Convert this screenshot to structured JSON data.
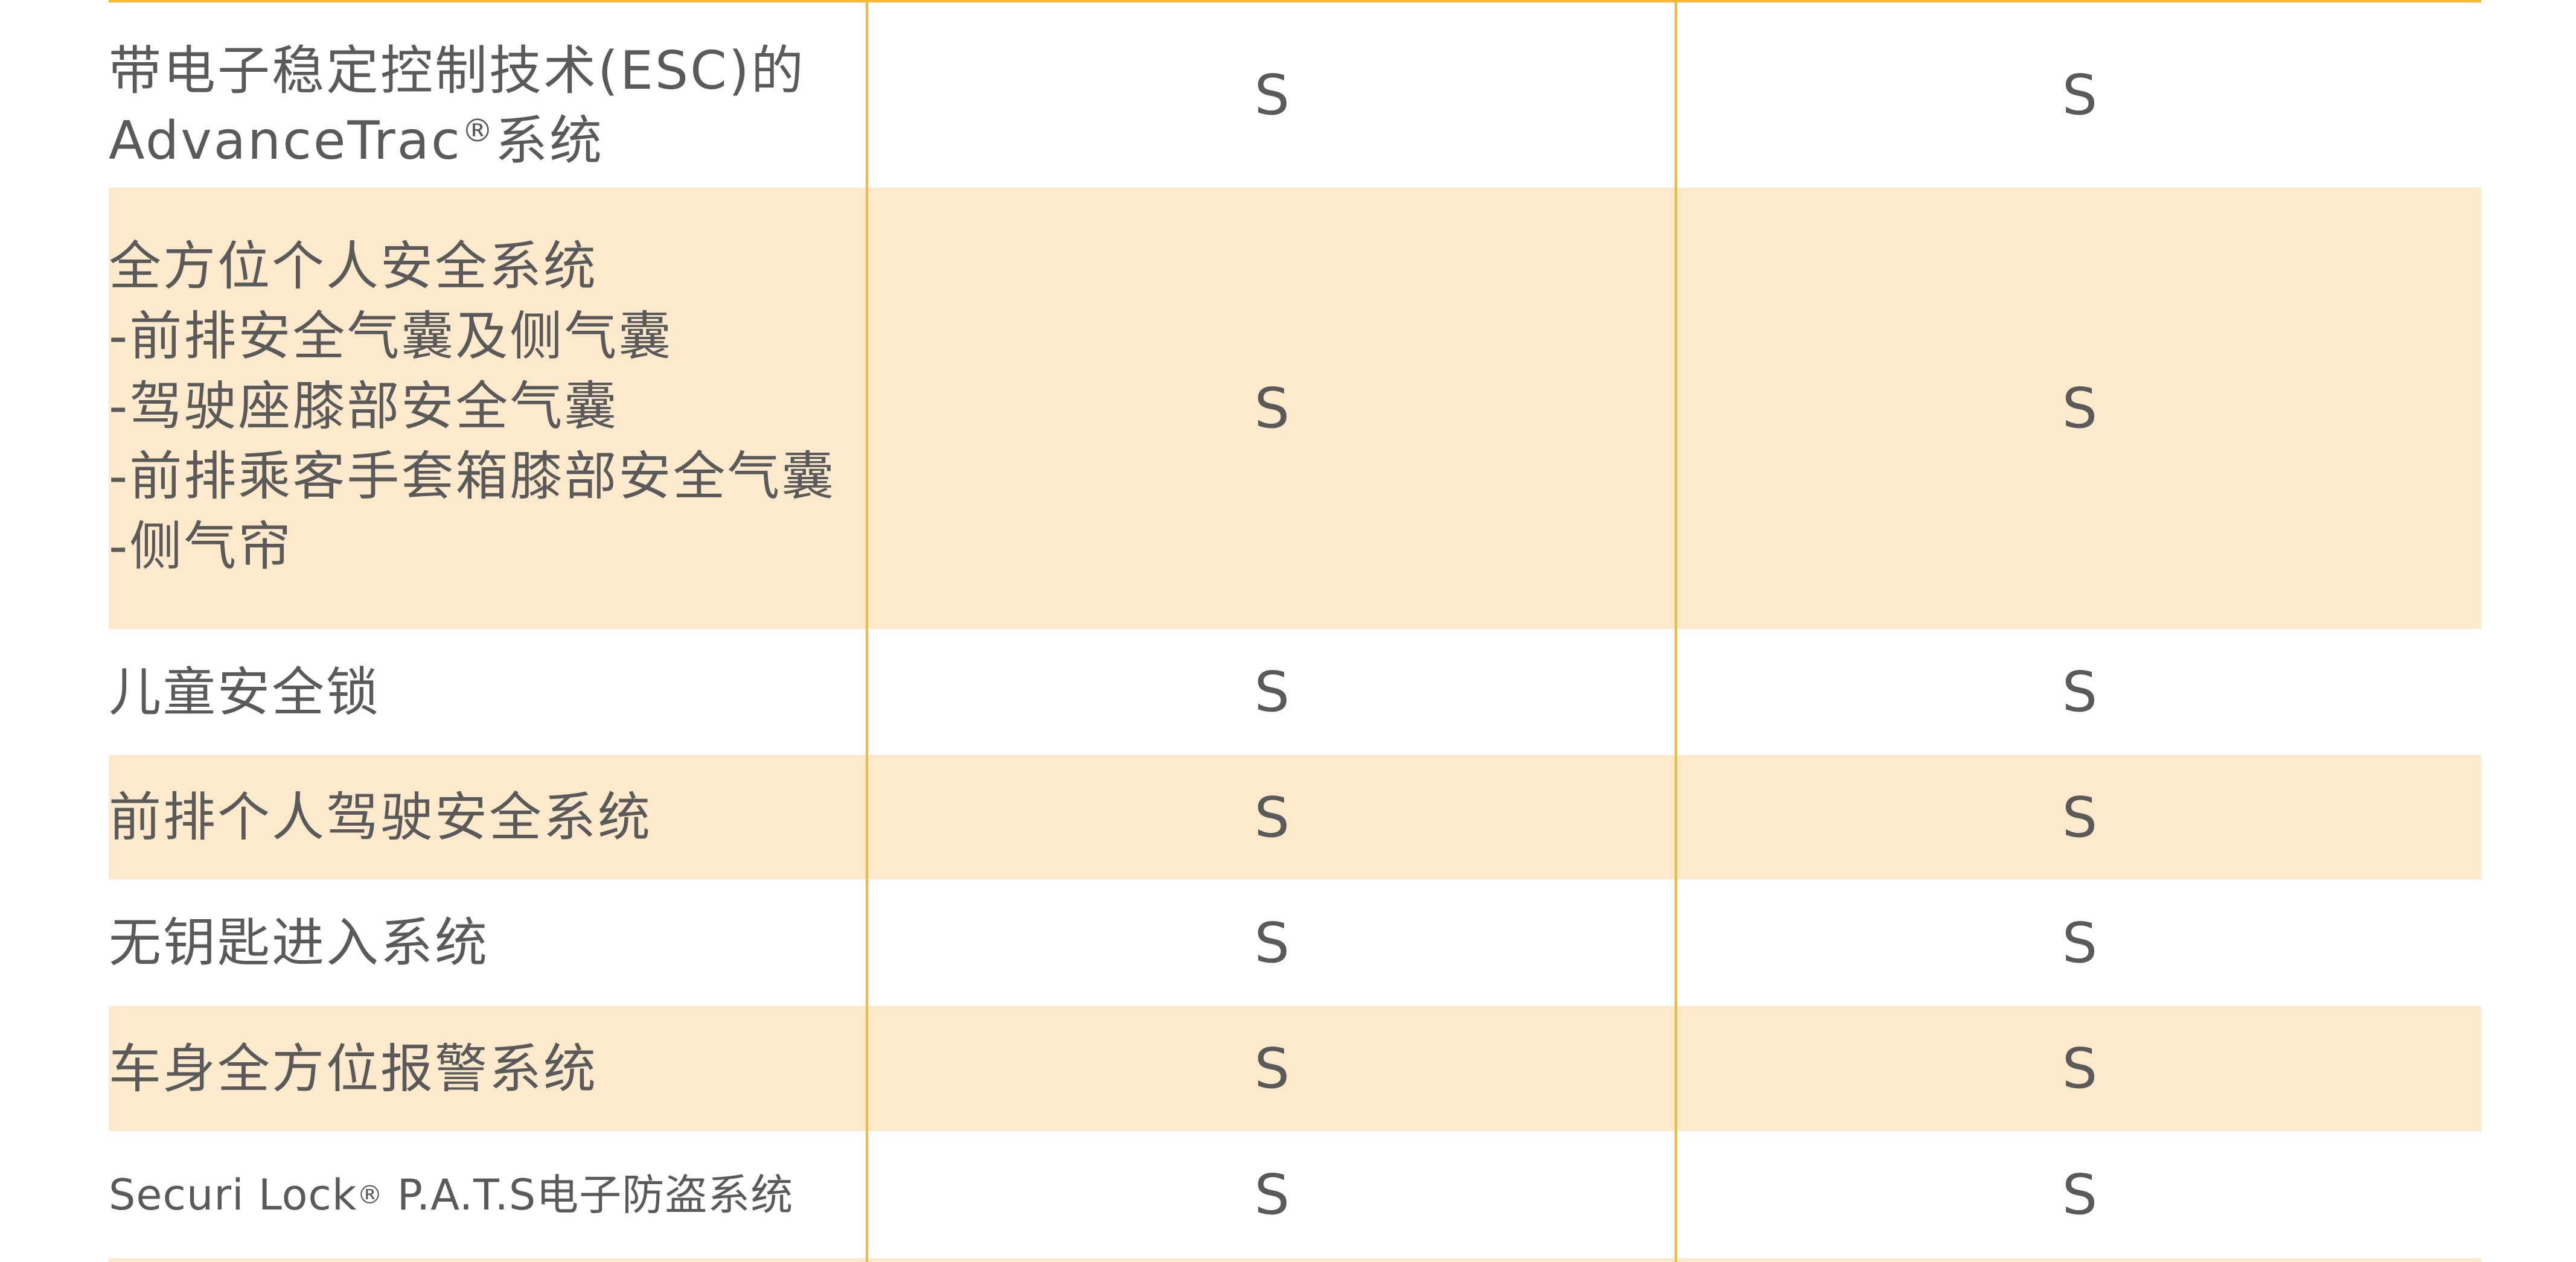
{
  "table": {
    "rows": [
      {
        "feature_lines": [
          "带电子稳定控制技术(ESC)的",
          "AdvanceTrac"
        ],
        "feature_reg": "®",
        "feature_suffix": "系统",
        "col1": "S",
        "col2": "S"
      },
      {
        "feature_lines": [
          "全方位个人安全系统",
          "-前排安全气囊及侧气囊",
          "-驾驶座膝部安全气囊",
          "-前排乘客手套箱膝部安全气囊",
          "-侧气帘"
        ],
        "col1": "S",
        "col2": "S"
      },
      {
        "feature": "儿童安全锁",
        "col1": "S",
        "col2": "S"
      },
      {
        "feature": "前排个人驾驶安全系统",
        "col1": "S",
        "col2": "S"
      },
      {
        "feature": "无钥匙进入系统",
        "col1": "S",
        "col2": "S"
      },
      {
        "feature": "车身全方位报警系统",
        "col1": "S",
        "col2": "S"
      },
      {
        "feature_prefix": "Securi Lock",
        "feature_reg": "®",
        "feature_suffix": " P.A.T.S电子防盗系统",
        "col1": "S",
        "col2": "S"
      }
    ]
  },
  "colors": {
    "rule": "#f5b83d",
    "shade": "#fde9cb",
    "text": "#5a5a5a"
  }
}
